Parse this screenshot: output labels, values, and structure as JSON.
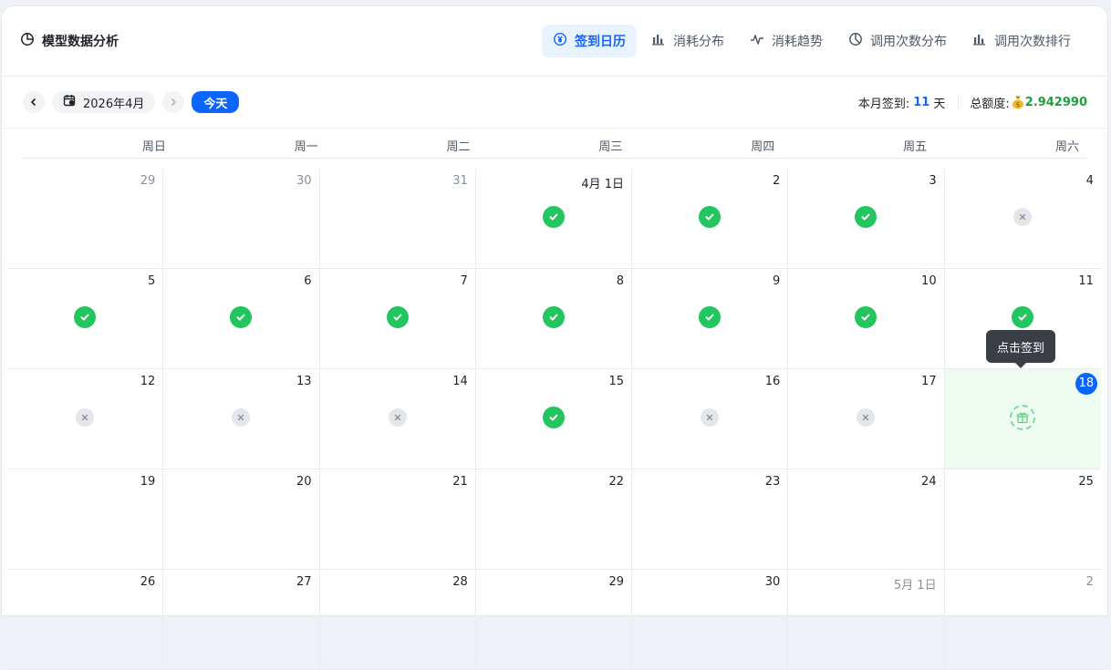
{
  "header": {
    "title": "模型数据分析",
    "tabs": [
      {
        "label": "签到日历",
        "icon": "yen-circle-icon",
        "active": true
      },
      {
        "label": "消耗分布",
        "icon": "bar-chart-icon",
        "active": false
      },
      {
        "label": "消耗趋势",
        "icon": "pulse-icon",
        "active": false
      },
      {
        "label": "调用次数分布",
        "icon": "pie-chart-icon",
        "active": false
      },
      {
        "label": "调用次数排行",
        "icon": "bar-chart-icon",
        "active": false
      }
    ]
  },
  "toolbar": {
    "month": "2026年4月",
    "today_label": "今天",
    "checkin_prefix": "本月签到:",
    "checkin_count": "11",
    "checkin_unit": "天",
    "quota_label": "总额度:",
    "quota_value": "2.942990"
  },
  "weekdays": [
    "周日",
    "周一",
    "周二",
    "周三",
    "周四",
    "周五",
    "周六"
  ],
  "days": [
    {
      "label": "29",
      "other": true,
      "status": "none"
    },
    {
      "label": "30",
      "other": true,
      "status": "none"
    },
    {
      "label": "31",
      "other": true,
      "status": "none"
    },
    {
      "label": "4月 1日",
      "other": false,
      "status": "ok"
    },
    {
      "label": "2",
      "other": false,
      "status": "ok"
    },
    {
      "label": "3",
      "other": false,
      "status": "ok"
    },
    {
      "label": "4",
      "other": false,
      "status": "miss"
    },
    {
      "label": "5",
      "other": false,
      "status": "ok"
    },
    {
      "label": "6",
      "other": false,
      "status": "ok"
    },
    {
      "label": "7",
      "other": false,
      "status": "ok"
    },
    {
      "label": "8",
      "other": false,
      "status": "ok"
    },
    {
      "label": "9",
      "other": false,
      "status": "ok"
    },
    {
      "label": "10",
      "other": false,
      "status": "ok"
    },
    {
      "label": "11",
      "other": false,
      "status": "ok"
    },
    {
      "label": "12",
      "other": false,
      "status": "miss"
    },
    {
      "label": "13",
      "other": false,
      "status": "miss"
    },
    {
      "label": "14",
      "other": false,
      "status": "miss"
    },
    {
      "label": "15",
      "other": false,
      "status": "ok"
    },
    {
      "label": "16",
      "other": false,
      "status": "miss"
    },
    {
      "label": "17",
      "other": false,
      "status": "miss"
    },
    {
      "label": "18",
      "other": false,
      "status": "today"
    },
    {
      "label": "19",
      "other": false,
      "status": "none"
    },
    {
      "label": "20",
      "other": false,
      "status": "none"
    },
    {
      "label": "21",
      "other": false,
      "status": "none"
    },
    {
      "label": "22",
      "other": false,
      "status": "none"
    },
    {
      "label": "23",
      "other": false,
      "status": "none"
    },
    {
      "label": "24",
      "other": false,
      "status": "none"
    },
    {
      "label": "25",
      "other": false,
      "status": "none"
    },
    {
      "label": "26",
      "other": false,
      "status": "none"
    },
    {
      "label": "27",
      "other": false,
      "status": "none"
    },
    {
      "label": "28",
      "other": false,
      "status": "none"
    },
    {
      "label": "29",
      "other": false,
      "status": "none"
    },
    {
      "label": "30",
      "other": false,
      "status": "none"
    },
    {
      "label": "5月 1日",
      "other": true,
      "status": "none"
    },
    {
      "label": "2",
      "other": true,
      "status": "none"
    }
  ],
  "tooltip": "点击签到",
  "colors": {
    "accent": "#0a66ff",
    "success": "#22c55e",
    "quota": "#1aa33a",
    "today_bg": "#eefbf0"
  }
}
